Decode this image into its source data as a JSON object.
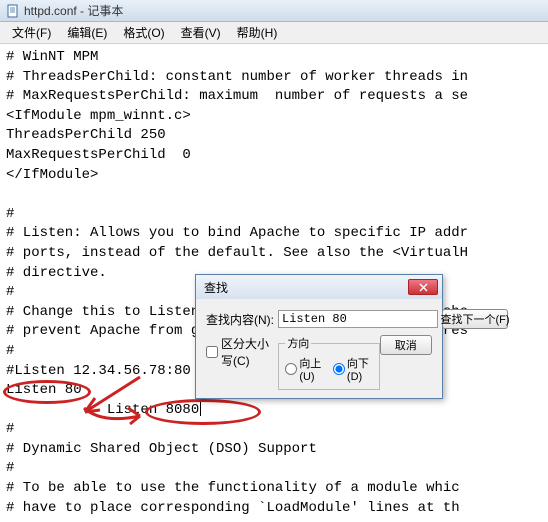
{
  "titlebar": {
    "title": "httpd.conf - 记事本"
  },
  "menubar": {
    "items": [
      {
        "label": "文件(F)"
      },
      {
        "label": "编辑(E)"
      },
      {
        "label": "格式(O)"
      },
      {
        "label": "查看(V)"
      },
      {
        "label": "帮助(H)"
      }
    ]
  },
  "editor_text": "# WinNT MPM\n# ThreadsPerChild: constant number of worker threads in\n# MaxRequestsPerChild: maximum  number of requests a se\n<IfModule mpm_winnt.c>\nThreadsPerChild 250\nMaxRequestsPerChild  0\n</IfModule>\n\n#\n# Listen: Allows you to bind Apache to specific IP addr\n# ports, instead of the default. See also the <VirtualH\n# directive.\n#\n# Change this to Listen on specific IP addresses as sho\n# prevent Apache from glomming onto all bound IP addres\n#\n#Listen 12.34.56.78:80\nListen 80\n            Listen 8080",
  "editor_tail": "\n#\n# Dynamic Shared Object (DSO) Support\n#\n# To be able to use the functionality of a module whic\n# have to place corresponding `LoadModule' lines at th",
  "dialog": {
    "title": "查找",
    "find_label": "查找内容(N):",
    "find_value": "Listen 80",
    "find_next": "查找下一个(F)",
    "cancel": "取消",
    "case_label": "区分大小写(C)",
    "direction_legend": "方向",
    "up_label": "向上(U)",
    "down_label": "向下(D)"
  }
}
